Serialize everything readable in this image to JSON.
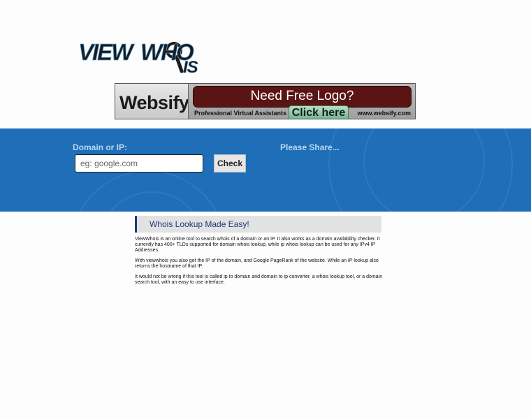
{
  "logo": {
    "alt": "VIEW WHOIS",
    "part1": "VIEW",
    "part2": "WHO",
    "part3": "IS"
  },
  "ad": {
    "brand": "Websify.",
    "headline": "Need Free Logo?",
    "tagline": "Professional Virtual Assistants",
    "cta": "Click here",
    "url": "www.websify.com"
  },
  "search": {
    "label": "Domain or IP:",
    "placeholder": "eg: google.com",
    "value": "",
    "button": "Check"
  },
  "share": {
    "label": "Please Share..."
  },
  "content": {
    "title": "Whois Lookup Made Easy!",
    "paragraphs": [
      "ViewWhois is an online tool to search whois of a domain or an IP. It also works as a domain availability checker. It currently has 400+ TLDs supported for domain whois lookup, while ip whois lookup can be used for any IPv4 IP Addresses.",
      "With viewwhois you also get the IP of the domain, and Google PageRank of the website. While an IP lookup also returns the hostname of that IP.",
      "It would not be wrong if this tool is called ip to domain and domain to ip converter, a whois lookup tool, or a domain search tool, with an easy to use interface."
    ]
  },
  "colors": {
    "band": "#1e6fb8",
    "label": "#b8d8f2",
    "title": "#1d3a7a",
    "ad_red": "#5a1414"
  }
}
